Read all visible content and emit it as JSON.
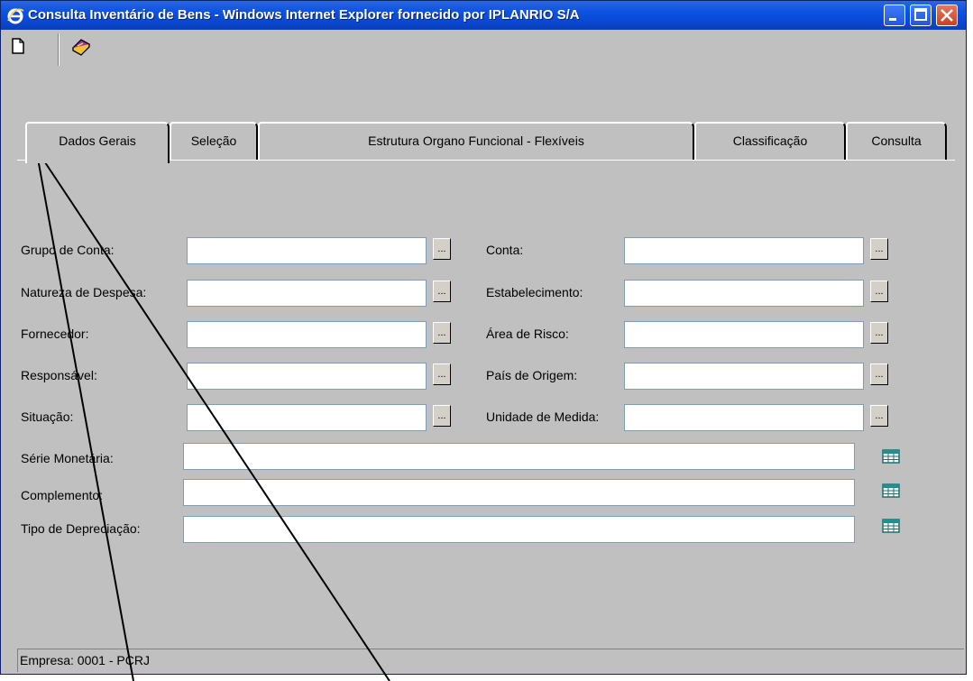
{
  "window": {
    "title": "Consulta Inventário de Bens - Windows Internet Explorer fornecido por IPLANRIO S/A"
  },
  "toolbar": {
    "new_icon": "document-icon",
    "book_icon": "book-icon"
  },
  "tabs": [
    {
      "label": "Dados Gerais",
      "active": true
    },
    {
      "label": "Seleção",
      "active": false
    },
    {
      "label": "Estrutura Organo Funcional - Flexíveis",
      "active": false
    },
    {
      "label": "Classificação",
      "active": false
    },
    {
      "label": "Consulta",
      "active": false
    }
  ],
  "form": {
    "left": [
      {
        "label": "Grupo de Conta:",
        "value": "",
        "button": "..."
      },
      {
        "label": "Natureza de Despesa:",
        "value": "",
        "button": "..."
      },
      {
        "label": "Fornecedor:",
        "value": "",
        "button": "..."
      },
      {
        "label": "Responsável:",
        "value": "",
        "button": "..."
      },
      {
        "label": "Situação:",
        "value": "",
        "button": "..."
      }
    ],
    "right": [
      {
        "label": "Conta:",
        "value": "",
        "button": "..."
      },
      {
        "label": "Estabelecimento:",
        "value": "",
        "button": "..."
      },
      {
        "label": "Área de Risco:",
        "value": "",
        "button": "..."
      },
      {
        "label": "País de Origem:",
        "value": "",
        "button": "..."
      },
      {
        "label": "Unidade de Medida:",
        "value": "",
        "button": "..."
      }
    ],
    "wide": [
      {
        "label": "Série Monetária:",
        "value": "",
        "icon": "table-grid-icon"
      },
      {
        "label": "Complemento:",
        "value": "",
        "icon": "table-grid-icon"
      },
      {
        "label": "Tipo de Depreciação:",
        "value": "",
        "icon": "table-grid-icon"
      }
    ]
  },
  "status": {
    "text": "Empresa: 0001 - PCRJ"
  },
  "colors": {
    "titlebar": "#0a48d4",
    "face": "#c0c0c0",
    "field_border": "#7f9db9"
  }
}
